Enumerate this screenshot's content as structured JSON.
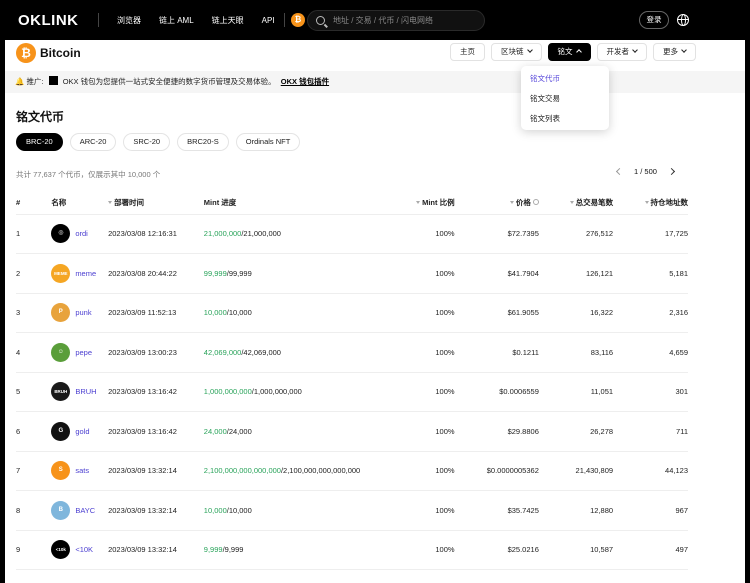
{
  "topnav": {
    "logo": "OKLINK",
    "links": [
      "浏览器",
      "链上 AML",
      "链上天眼",
      "API"
    ],
    "search_placeholder": "地址 / 交易 / 代币 / 闪电网络",
    "login_label": "登录"
  },
  "chain": {
    "name": "Bitcoin",
    "nav": [
      {
        "label": "主页",
        "dropdown": false,
        "active": false
      },
      {
        "label": "区块链",
        "dropdown": true,
        "active": false
      },
      {
        "label": "铭文",
        "dropdown": true,
        "active": true
      },
      {
        "label": "开发者",
        "dropdown": true,
        "active": false
      },
      {
        "label": "更多",
        "dropdown": true,
        "active": false
      }
    ]
  },
  "dropdown": {
    "items": [
      {
        "label": "铭文代币",
        "selected": true
      },
      {
        "label": "铭文交易",
        "selected": false
      },
      {
        "label": "铭文列表",
        "selected": false
      }
    ]
  },
  "promo": {
    "prefix": "推广:",
    "text": "OKX 钱包为您提供一站式安全便捷的数字货币管理及交易体验。",
    "link": "OKX 钱包插件"
  },
  "page": {
    "title": "铭文代币",
    "tabs": [
      "BRC-20",
      "ARC-20",
      "SRC-20",
      "BRC20-S",
      "Ordinals NFT"
    ],
    "summary": "共计 77,637 个代币，仅展示其中 10,000 个",
    "pager": "1 / 500"
  },
  "table": {
    "headers": {
      "idx": "#",
      "name": "名称",
      "time": "部署时间",
      "mint": "Mint 进度",
      "ratio": "Mint 比例",
      "price": "价格",
      "trades": "总交易笔数",
      "holders": "持仓地址数"
    },
    "rows": [
      {
        "idx": "1",
        "name": "ordi",
        "time": "2023/03/08 12:16:31",
        "minted": "21,000,000",
        "total": "/21,000,000",
        "ratio": "100%",
        "price": "$72.7395",
        "trades": "276,512",
        "holders": "17,725",
        "icon_color": "#000000",
        "icon_text": "◎"
      },
      {
        "idx": "2",
        "name": "meme",
        "time": "2023/03/08 20:44:22",
        "minted": "99,999",
        "total": "/99,999",
        "ratio": "100%",
        "price": "$41.7904",
        "trades": "126,121",
        "holders": "5,181",
        "icon_color": "#f5a623",
        "icon_text": "MEME"
      },
      {
        "idx": "3",
        "name": "punk",
        "time": "2023/03/09 11:52:13",
        "minted": "10,000",
        "total": "/10,000",
        "ratio": "100%",
        "price": "$61.9055",
        "trades": "16,322",
        "holders": "2,316",
        "icon_color": "#e8a33c",
        "icon_text": "P"
      },
      {
        "idx": "4",
        "name": "pepe",
        "time": "2023/03/09 13:00:23",
        "minted": "42,069,000",
        "total": "/42,069,000",
        "ratio": "100%",
        "price": "$0.1211",
        "trades": "83,116",
        "holders": "4,659",
        "icon_color": "#5a9e3a",
        "icon_text": "☺"
      },
      {
        "idx": "5",
        "name": "BRUH",
        "time": "2023/03/09 13:16:42",
        "minted": "1,000,000,000",
        "total": "/1,000,000,000",
        "ratio": "100%",
        "price": "$0.0006559",
        "trades": "11,051",
        "holders": "301",
        "icon_color": "#1a1a1a",
        "icon_text": "BRUH"
      },
      {
        "idx": "6",
        "name": "gold",
        "time": "2023/03/09 13:16:42",
        "minted": "24,000",
        "total": "/24,000",
        "ratio": "100%",
        "price": "$29.8806",
        "trades": "26,278",
        "holders": "711",
        "icon_color": "#111111",
        "icon_text": "G"
      },
      {
        "idx": "7",
        "name": "sats",
        "time": "2023/03/09 13:32:14",
        "minted": "2,100,000,000,000,000",
        "total": "/2,100,000,000,000,000",
        "ratio": "100%",
        "price": "$0.0000005362",
        "trades": "21,430,809",
        "holders": "44,123",
        "icon_color": "#f7931a",
        "icon_text": "S"
      },
      {
        "idx": "8",
        "name": "BAYC",
        "time": "2023/03/09 13:32:14",
        "minted": "10,000",
        "total": "/10,000",
        "ratio": "100%",
        "price": "$35.7425",
        "trades": "12,880",
        "holders": "967",
        "icon_color": "#7fb6dc",
        "icon_text": "B"
      },
      {
        "idx": "9",
        "name": "<10K",
        "time": "2023/03/09 13:32:14",
        "minted": "9,999",
        "total": "/9,999",
        "ratio": "100%",
        "price": "$25.0216",
        "trades": "10,587",
        "holders": "497",
        "icon_color": "#000000",
        "icon_text": "<10k"
      }
    ]
  },
  "colors": {
    "accent": "#4b3fd1",
    "mint_green": "#29a35a",
    "bitcoin_orange": "#f7931a"
  }
}
